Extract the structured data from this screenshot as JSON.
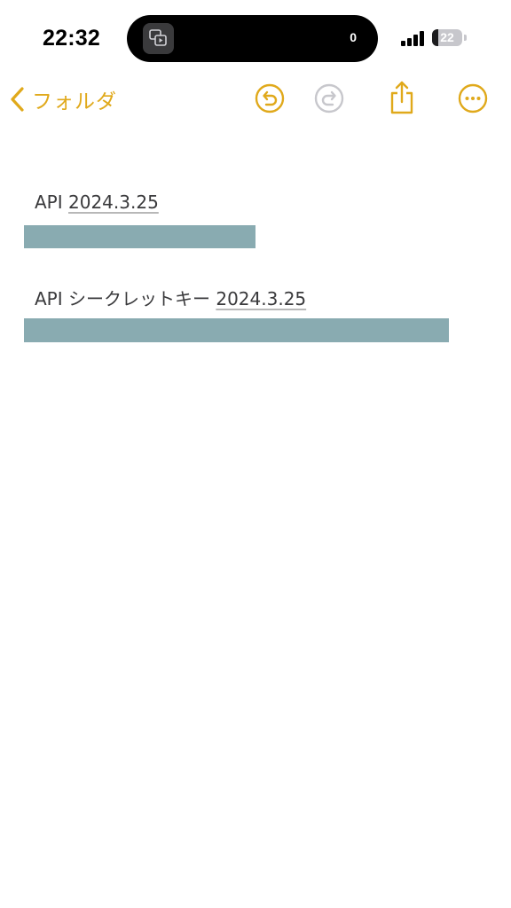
{
  "status_bar": {
    "time": "22:32",
    "island_count": "0",
    "island_icon": "screen-mirroring-icon",
    "battery_level": "22",
    "battery_fraction": 0.22
  },
  "nav": {
    "back_label": "フォルダ",
    "back_icon": "chevron-left-icon",
    "accent_color": "#e0a91b",
    "disabled_color": "#c7c7cc",
    "icons": [
      "undo-icon",
      "redo-icon",
      "share-icon",
      "more-icon"
    ]
  },
  "note": {
    "lines": [
      {
        "prefix": "API",
        "date": "2024.3.25",
        "redacted": true
      },
      {
        "prefix": "API シークレットキー",
        "date": "2024.3.25",
        "redacted": true
      }
    ],
    "redaction_color": "#89abb1"
  }
}
